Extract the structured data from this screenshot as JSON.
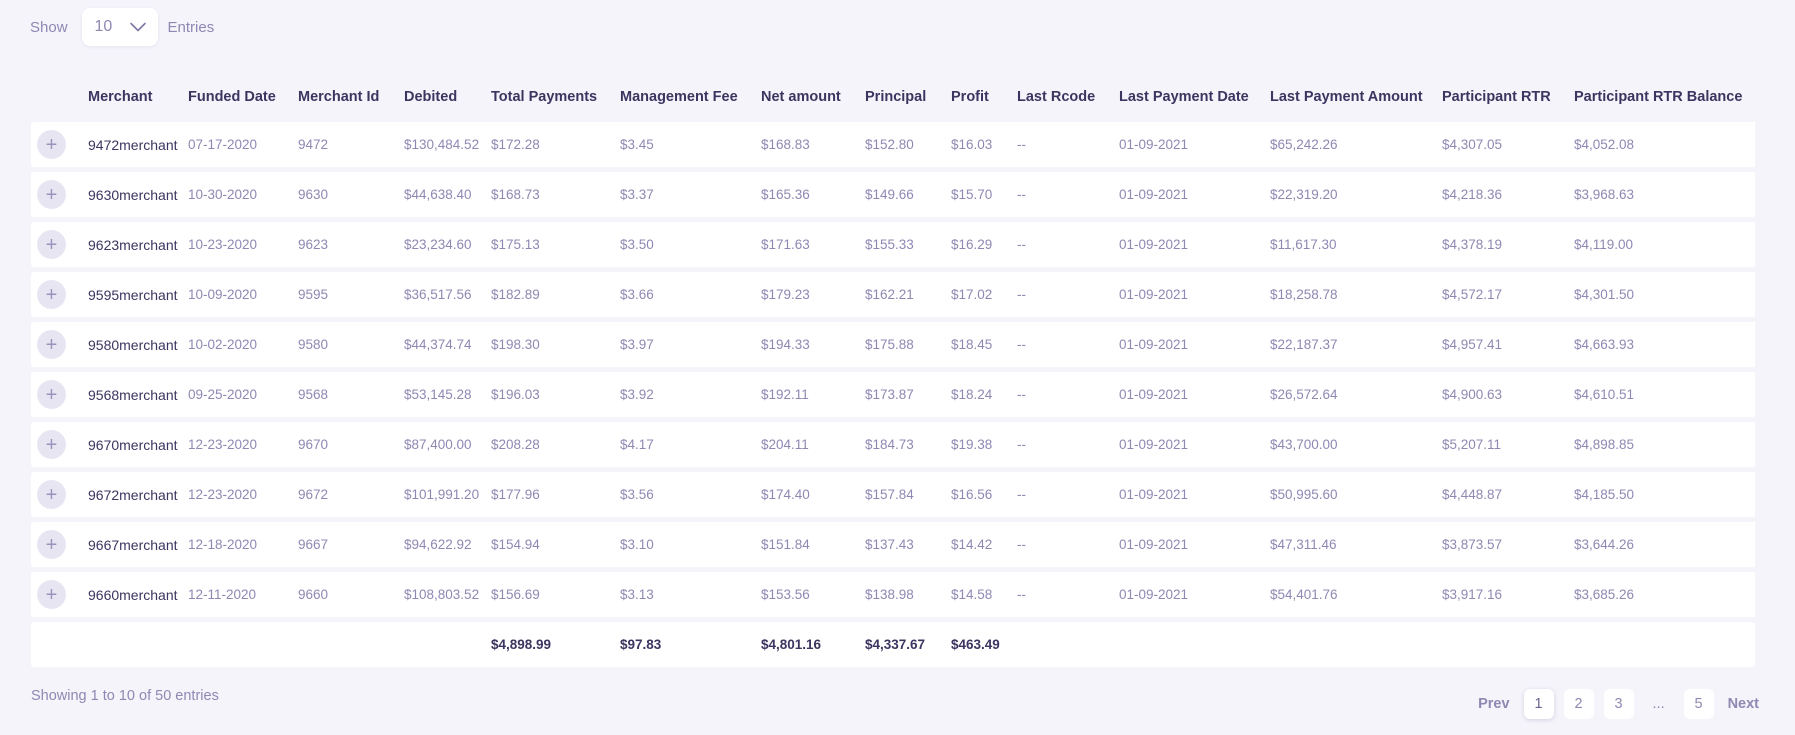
{
  "length_control": {
    "show_label": "Show",
    "selected": "10",
    "entries_label": "Entries"
  },
  "columns": [
    "Merchant",
    "Funded Date",
    "Merchant Id",
    "Debited",
    "Total Payments",
    "Management Fee",
    "Net amount",
    "Principal",
    "Profit",
    "Last Rcode",
    "Last Payment Date",
    "Last Payment Amount",
    "Participant RTR",
    "Participant RTR Balance"
  ],
  "rows": [
    [
      "9472merchant",
      "07-17-2020",
      "9472",
      "$130,484.52",
      "$172.28",
      "$3.45",
      "$168.83",
      "$152.80",
      "$16.03",
      "--",
      "01-09-2021",
      "$65,242.26",
      "$4,307.05",
      "$4,052.08"
    ],
    [
      "9630merchant",
      "10-30-2020",
      "9630",
      "$44,638.40",
      "$168.73",
      "$3.37",
      "$165.36",
      "$149.66",
      "$15.70",
      "--",
      "01-09-2021",
      "$22,319.20",
      "$4,218.36",
      "$3,968.63"
    ],
    [
      "9623merchant",
      "10-23-2020",
      "9623",
      "$23,234.60",
      "$175.13",
      "$3.50",
      "$171.63",
      "$155.33",
      "$16.29",
      "--",
      "01-09-2021",
      "$11,617.30",
      "$4,378.19",
      "$4,119.00"
    ],
    [
      "9595merchant",
      "10-09-2020",
      "9595",
      "$36,517.56",
      "$182.89",
      "$3.66",
      "$179.23",
      "$162.21",
      "$17.02",
      "--",
      "01-09-2021",
      "$18,258.78",
      "$4,572.17",
      "$4,301.50"
    ],
    [
      "9580merchant",
      "10-02-2020",
      "9580",
      "$44,374.74",
      "$198.30",
      "$3.97",
      "$194.33",
      "$175.88",
      "$18.45",
      "--",
      "01-09-2021",
      "$22,187.37",
      "$4,957.41",
      "$4,663.93"
    ],
    [
      "9568merchant",
      "09-25-2020",
      "9568",
      "$53,145.28",
      "$196.03",
      "$3.92",
      "$192.11",
      "$173.87",
      "$18.24",
      "--",
      "01-09-2021",
      "$26,572.64",
      "$4,900.63",
      "$4,610.51"
    ],
    [
      "9670merchant",
      "12-23-2020",
      "9670",
      "$87,400.00",
      "$208.28",
      "$4.17",
      "$204.11",
      "$184.73",
      "$19.38",
      "--",
      "01-09-2021",
      "$43,700.00",
      "$5,207.11",
      "$4,898.85"
    ],
    [
      "9672merchant",
      "12-23-2020",
      "9672",
      "$101,991.20",
      "$177.96",
      "$3.56",
      "$174.40",
      "$157.84",
      "$16.56",
      "--",
      "01-09-2021",
      "$50,995.60",
      "$4,448.87",
      "$4,185.50"
    ],
    [
      "9667merchant",
      "12-18-2020",
      "9667",
      "$94,622.92",
      "$154.94",
      "$3.10",
      "$151.84",
      "$137.43",
      "$14.42",
      "--",
      "01-09-2021",
      "$47,311.46",
      "$3,873.57",
      "$3,644.26"
    ],
    [
      "9660merchant",
      "12-11-2020",
      "9660",
      "$108,803.52",
      "$156.69",
      "$3.13",
      "$153.56",
      "$138.98",
      "$14.58",
      "--",
      "01-09-2021",
      "$54,401.76",
      "$3,917.16",
      "$3,685.26"
    ]
  ],
  "totals": {
    "total_payments": "$4,898.99",
    "management_fee": "$97.83",
    "net_amount": "$4,801.16",
    "principal": "$4,337.67",
    "profit": "$463.49"
  },
  "footer": {
    "info": "Showing 1 to 10 of 50 entries"
  },
  "pagination": {
    "prev": "Prev",
    "next": "Next",
    "pages": [
      "1",
      "2",
      "3"
    ],
    "ellipsis": "...",
    "last": "5",
    "current": "1"
  },
  "icons": {
    "expand": "plus-icon",
    "dropdown": "chevron-down-icon"
  },
  "colors": {
    "background": "#f4f4fa",
    "heading": "#3d3560",
    "text": "#8f88b3",
    "row_bg": "#ffffff"
  }
}
